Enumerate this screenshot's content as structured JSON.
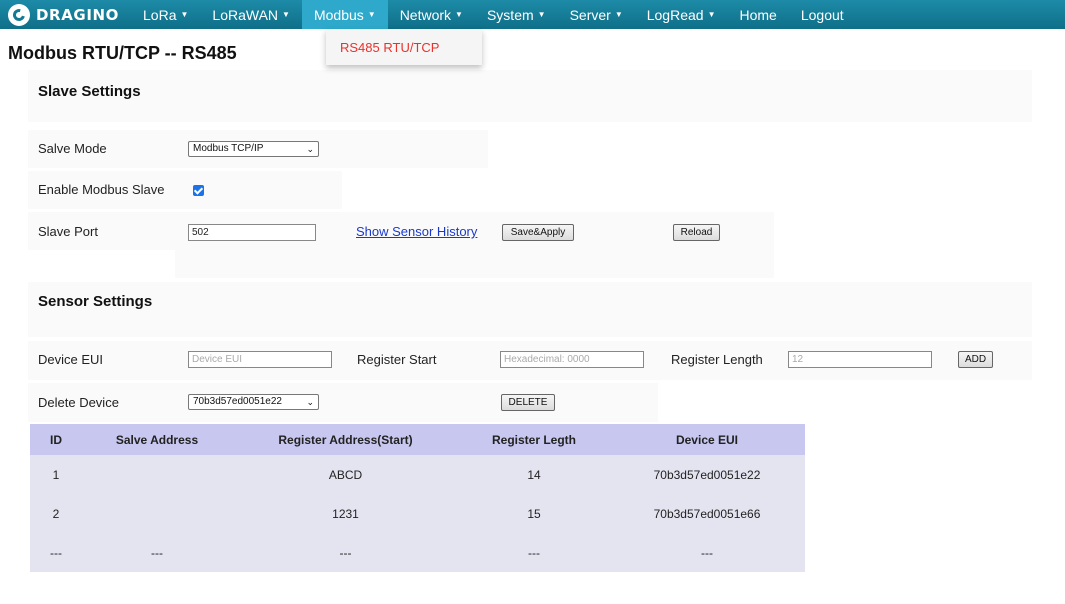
{
  "nav": {
    "logo_text": "DRAGINO",
    "items": [
      {
        "label": "LoRa",
        "caret": "▼"
      },
      {
        "label": "LoRaWAN",
        "caret": "▼"
      },
      {
        "label": "Modbus",
        "caret": "▼"
      },
      {
        "label": "Network",
        "caret": "▼"
      },
      {
        "label": "System",
        "caret": "▼"
      },
      {
        "label": "Server",
        "caret": "▼"
      },
      {
        "label": "LogRead",
        "caret": "▼"
      },
      {
        "label": "Home",
        "caret": ""
      },
      {
        "label": "Logout",
        "caret": ""
      }
    ],
    "active": "Modbus",
    "dropdown_item": "RS485 RTU/TCP"
  },
  "page_title": "Modbus RTU/TCP -- RS485",
  "slave": {
    "title": "Slave Settings",
    "mode_label": "Salve Mode",
    "mode_value": "Modbus TCP/IP",
    "enable_label": "Enable Modbus Slave",
    "enable_checked": true,
    "port_label": "Slave Port",
    "port_value": "502",
    "history_link": "Show Sensor History",
    "save_button": "Save&Apply",
    "reload_button": "Reload"
  },
  "sensor": {
    "title": "Sensor Settings",
    "eui_label": "Device EUI",
    "eui_placeholder": "Device EUI",
    "reg_start_label": "Register Start",
    "reg_start_placeholder": "Hexadecimal: 0000",
    "reg_length_label": "Register Length",
    "reg_length_placeholder": "12",
    "add_button": "ADD",
    "delete_label": "Delete Device",
    "delete_value": "70b3d57ed0051e22",
    "delete_button": "DELETE"
  },
  "table": {
    "headers": [
      "ID",
      "Salve Address",
      "Register Address(Start)",
      "Register Legth",
      "Device EUI"
    ],
    "rows": [
      [
        "1",
        "",
        "ABCD",
        "14",
        "70b3d57ed0051e22"
      ],
      [
        "2",
        "",
        "1231",
        "15",
        "70b3d57ed0051e66"
      ],
      [
        "---",
        "---",
        "---",
        "---",
        "---"
      ]
    ]
  },
  "colors": {
    "nav_bg": "#137a95",
    "nav_active": "#2ea9cb",
    "dropdown_text": "#e8322c",
    "table_header": "#c7c7ef",
    "table_row": "#e4e4f1",
    "link": "#1a39c9"
  }
}
